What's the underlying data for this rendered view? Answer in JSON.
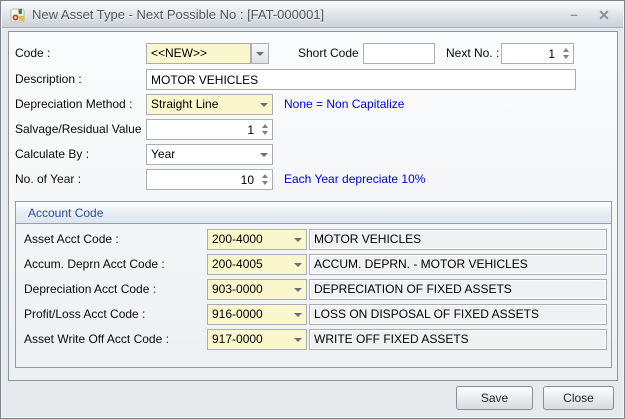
{
  "window": {
    "title": "New Asset Type - Next Possible No : [FAT-000001]",
    "minimize_glyph": "–",
    "close_glyph": "✕"
  },
  "form": {
    "code": {
      "label": "Code :",
      "value": "<<NEW>>"
    },
    "short_code": {
      "label": "Short Code :",
      "value": ""
    },
    "next_no": {
      "label": "Next No. :",
      "value": "1"
    },
    "description": {
      "label": "Description :",
      "value": "MOTOR VEHICLES"
    },
    "depreciation_method": {
      "label": "Depreciation Method :",
      "value": "Straight Line",
      "hint": "None = Non Capitalize"
    },
    "salvage_value": {
      "label": "Salvage/Residual Value :",
      "value": "1"
    },
    "calculate_by": {
      "label": "Calculate By :",
      "value": "Year"
    },
    "no_of_year": {
      "label": "No. of Year :",
      "value": "10",
      "hint": "Each Year depreciate 10%"
    }
  },
  "account_code": {
    "title": "Account Code",
    "rows": [
      {
        "label": "Asset Acct Code :",
        "code": "200-4000",
        "description": "MOTOR VEHICLES"
      },
      {
        "label": "Accum. Deprn Acct Code :",
        "code": "200-4005",
        "description": "ACCUM. DEPRN. - MOTOR VEHICLES"
      },
      {
        "label": "Depreciation Acct Code :",
        "code": "903-0000",
        "description": "DEPRECIATION OF FIXED ASSETS"
      },
      {
        "label": "Profit/Loss Acct Code :",
        "code": "916-0000",
        "description": "LOSS ON DISPOSAL OF FIXED ASSETS"
      },
      {
        "label": "Asset Write Off Acct Code :",
        "code": "917-0000",
        "description": "WRITE OFF FIXED ASSETS"
      }
    ]
  },
  "footer": {
    "save_label": "Save",
    "close_label": "Close"
  },
  "colors": {
    "editable_highlight": "#fbf7cd",
    "hint_blue": "#0000e0",
    "group_title_blue": "#29509c"
  }
}
